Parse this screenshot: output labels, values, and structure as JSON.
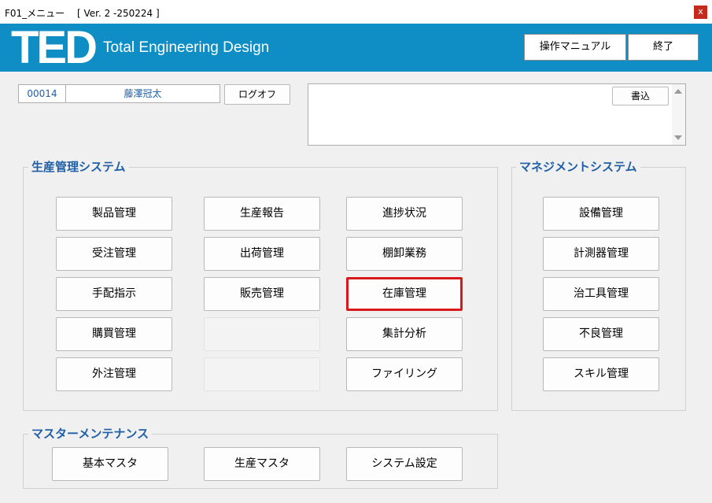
{
  "window": {
    "title": "F01_メニュー　 [ Ver. 2 -250224 ]",
    "close_label": "x"
  },
  "header": {
    "logo": "TED",
    "brand": "Total Engineering Design",
    "manual_label": "操作マニュアル",
    "exit_label": "終了",
    "color": "#0f8ec6"
  },
  "user": {
    "id": "00014",
    "name": "藤澤冠太",
    "logoff_label": "ログオフ"
  },
  "memo": {
    "write_label": "書込"
  },
  "production": {
    "title": "生産管理システム",
    "col1": [
      "製品管理",
      "受注管理",
      "手配指示",
      "購買管理",
      "外注管理"
    ],
    "col2": [
      "生産報告",
      "出荷管理",
      "販売管理",
      "",
      ""
    ],
    "col3": [
      "進捗状況",
      "棚卸業務",
      "在庫管理",
      "集計分析",
      "ファイリング"
    ]
  },
  "management": {
    "title": "マネジメントシステム",
    "items": [
      "設備管理",
      "計測器管理",
      "治工具管理",
      "不良管理",
      "スキル管理"
    ]
  },
  "master": {
    "title": "マスターメンテナンス",
    "items": [
      "基本マスタ",
      "生産マスタ",
      "システム設定"
    ]
  },
  "highlight_color": "#d7191c"
}
